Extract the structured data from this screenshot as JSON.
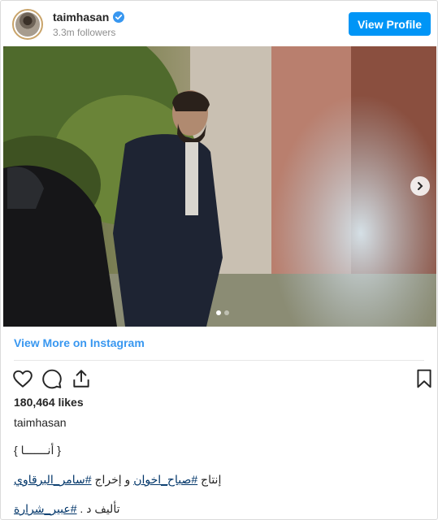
{
  "post": {
    "username": "taimhasan",
    "followers": "3.3m followers",
    "view_profile_label": "View Profile",
    "view_more_label": "View More on Instagram",
    "likes": "180,464 likes",
    "caption_username": "taimhasan",
    "caption_line1": "{ أنـــــــا }",
    "caption_line2_a": "إنتاج ",
    "caption_line2_tag1": "#صباح_اخوان",
    "caption_line2_b": " و إخراج ",
    "caption_line2_tag2": "#سامر_البرقاوي",
    "caption_line3_a": "تأليف د . ",
    "caption_line3_tag": "#عبير_شرارة"
  },
  "icons": {
    "verified": "verified-badge-icon",
    "like": "heart-icon",
    "comment": "comment-icon",
    "share": "share-icon",
    "save": "bookmark-icon",
    "next": "chevron-right-icon"
  },
  "carousel": {
    "count": 2,
    "active": 1
  },
  "colors": {
    "accent": "#0095f6",
    "link": "#3897f0",
    "hashtag": "#003569"
  }
}
